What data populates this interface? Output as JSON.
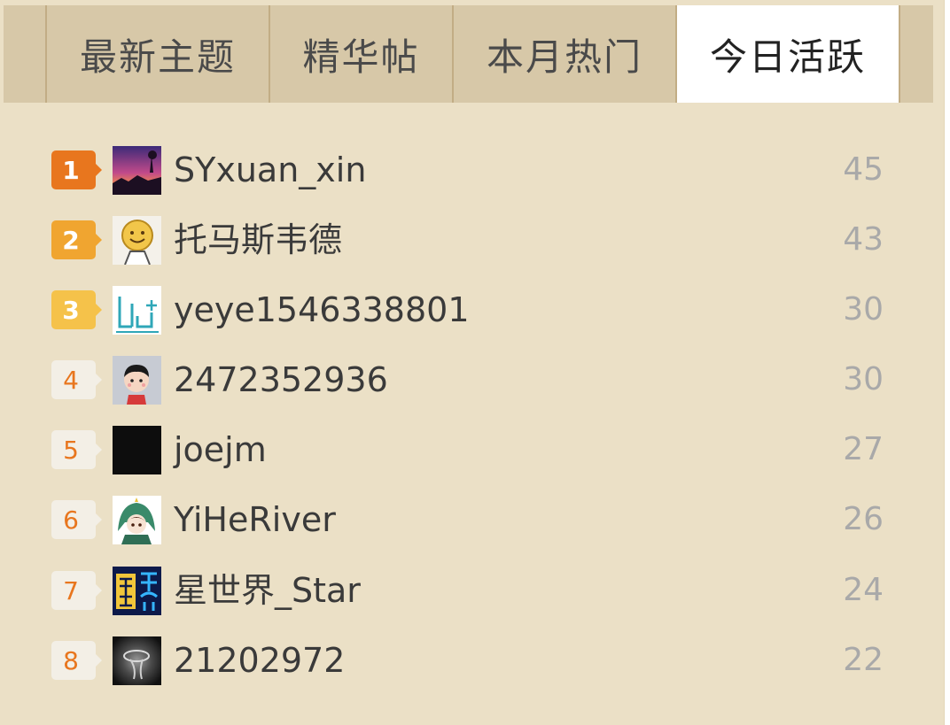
{
  "tabs": [
    {
      "label": "最新主题",
      "active": false
    },
    {
      "label": "精华帖",
      "active": false
    },
    {
      "label": "本月热门",
      "active": false
    },
    {
      "label": "今日活跃",
      "active": true
    }
  ],
  "users": [
    {
      "rank": "1",
      "name": "SYxuan_xin",
      "count": "45",
      "avatar": "sunset-landscape-avatar"
    },
    {
      "rank": "2",
      "name": "托马斯韦德",
      "count": "43",
      "avatar": "smiley-face-avatar"
    },
    {
      "rank": "3",
      "name": "yeye1546338801",
      "count": "30",
      "avatar": "teal-logo-avatar"
    },
    {
      "rank": "4",
      "name": "2472352936",
      "count": "30",
      "avatar": "cartoon-boy-avatar"
    },
    {
      "rank": "5",
      "name": "joejm",
      "count": "27",
      "avatar": "black-avatar"
    },
    {
      "rank": "6",
      "name": "YiHeRiver",
      "count": "26",
      "avatar": "anime-girl-avatar"
    },
    {
      "rank": "7",
      "name": "星世界_Star",
      "count": "24",
      "avatar": "star-world-logo-avatar"
    },
    {
      "rank": "8",
      "name": "21202972",
      "count": "22",
      "avatar": "dark-swirl-avatar"
    }
  ],
  "colors": {
    "panel_bg": "#ebe0c6",
    "tabbar_bg": "#d7c8a8",
    "rank1": "#e8761e",
    "rank2": "#f0a530",
    "rank3": "#f5c24a",
    "count_text": "#a9a9a9"
  }
}
